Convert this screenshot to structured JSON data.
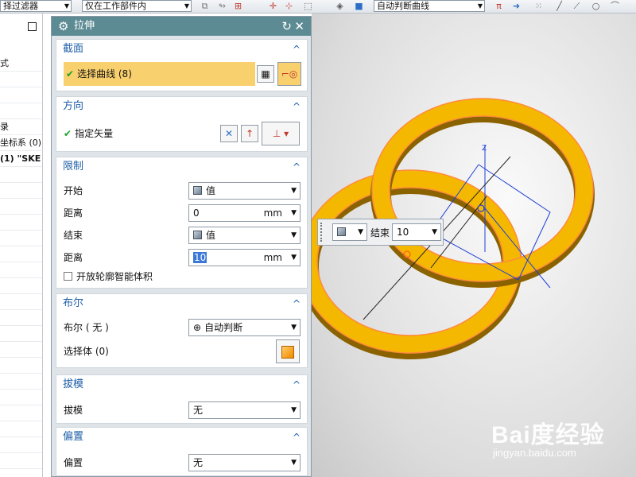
{
  "toolbar": {
    "filter_combo": "择过滤器",
    "scope_combo": "仅在工作部件内",
    "curve_rule_combo": "自动判断曲线"
  },
  "navigator": {
    "rows": [
      "式",
      "",
      "",
      "",
      "录",
      "坐标系 (0)",
      "(1) \"SKE",
      "",
      "",
      "",
      "",
      "",
      "",
      "",
      "",
      "",
      "",
      "",
      "",
      "",
      "",
      "",
      "",
      "",
      "",
      ""
    ],
    "bold_index": 6
  },
  "dialog": {
    "title": "拉伸",
    "section": {
      "header": "截面",
      "select_curve_label": "选择曲线 (8)"
    },
    "direction": {
      "header": "方向",
      "specify_vector_label": "指定矢量"
    },
    "limits": {
      "header": "限制",
      "start_label": "开始",
      "start_value": "值",
      "start_distance_label": "距离",
      "start_distance": "0",
      "start_unit": "mm",
      "end_label": "结束",
      "end_value": "值",
      "end_distance_label": "距离",
      "end_distance": "10",
      "end_unit": "mm",
      "open_profile_label": "开放轮廓智能体积"
    },
    "boolean": {
      "header": "布尔",
      "boolean_label": "布尔 ( 无 )",
      "boolean_value": "自动判断",
      "select_body_label": "选择体 (0)"
    },
    "draft": {
      "header": "拔模",
      "draft_label": "拔模",
      "draft_value": "无"
    },
    "offset": {
      "header": "偏置",
      "offset_label": "偏置",
      "offset_value": "无"
    }
  },
  "handle": {
    "end_label": "结束",
    "end_value": "10"
  },
  "watermark": {
    "main": "Bai度经验",
    "sub": "jingyan.baidu.com"
  },
  "colors": {
    "title_bar": "#5d8b94",
    "group_header": "#1f5fa8",
    "selection_highlight": "#f9d06e",
    "ring_fill": "#f5b800",
    "ring_edge": "#ff8a3d"
  }
}
